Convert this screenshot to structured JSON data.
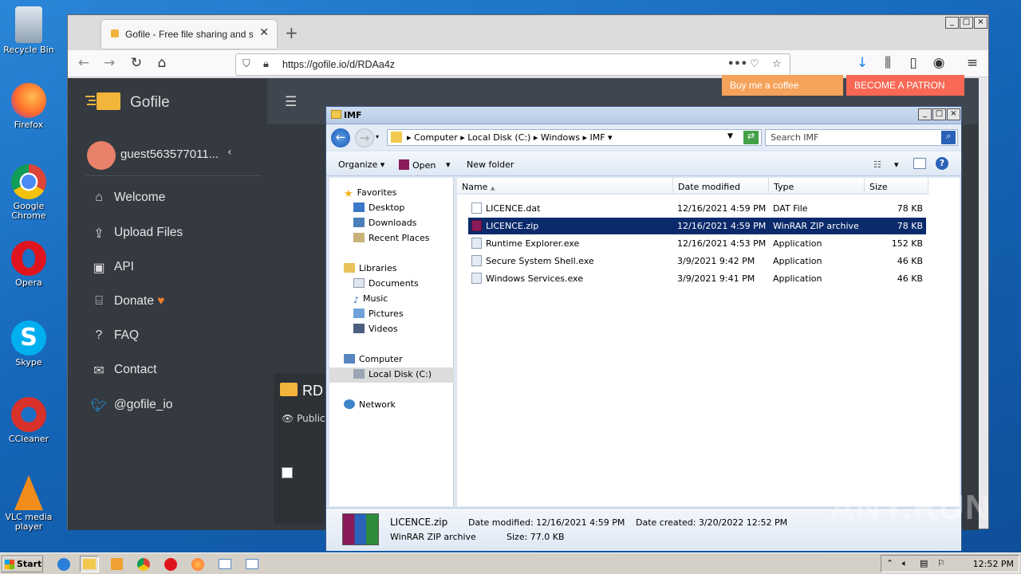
{
  "desktop": {
    "icons": [
      {
        "label": "Recycle Bin"
      },
      {
        "label": "Firefox"
      },
      {
        "label": "Google Chrome"
      },
      {
        "label": "Opera"
      },
      {
        "label": "Skype"
      },
      {
        "label": "CCleaner"
      },
      {
        "label": "VLC media player"
      }
    ]
  },
  "browser": {
    "tab_title": "Gofile - Free file sharing and storage",
    "url": "https://gofile.io/d/RDAa4z",
    "new_tab_glyph": "+",
    "tab_close_glyph": "✕"
  },
  "gofile": {
    "logo_text": "Gofile",
    "username": "guest563577011...",
    "menu": [
      {
        "icon": "home-icon",
        "label": "Welcome"
      },
      {
        "icon": "upload-icon",
        "label": "Upload Files"
      },
      {
        "icon": "api-icon",
        "label": "API"
      },
      {
        "icon": "gift-icon",
        "label": "Donate"
      },
      {
        "icon": "question-icon",
        "label": "FAQ"
      },
      {
        "icon": "envelope-icon",
        "label": "Contact"
      },
      {
        "icon": "twitter-icon",
        "label": "@gofile_io"
      }
    ],
    "buy_coffee_label": "Buy me a coffee",
    "patron_label": "BECOME A PATRON",
    "folder_title": "RD",
    "public_label": "Public"
  },
  "explorer": {
    "title": "IMF",
    "breadcrumb": [
      "Computer",
      "Local Disk (C:)",
      "Windows",
      "IMF"
    ],
    "search_placeholder": "Search IMF",
    "toolbar": {
      "organize": "Organize",
      "open": "Open",
      "new_folder": "New folder"
    },
    "nav": {
      "favorites": "Favorites",
      "desktop": "Desktop",
      "downloads": "Downloads",
      "recent": "Recent Places",
      "libraries": "Libraries",
      "documents": "Documents",
      "music": "Music",
      "pictures": "Pictures",
      "videos": "Videos",
      "computer": "Computer",
      "local_disk": "Local Disk (C:)",
      "network": "Network"
    },
    "columns": {
      "name": "Name",
      "date": "Date modified",
      "type": "Type",
      "size": "Size"
    },
    "files": [
      {
        "name": "LICENCE.dat",
        "date": "12/16/2021 4:59 PM",
        "type": "DAT File",
        "size": "78 KB"
      },
      {
        "name": "LICENCE.zip",
        "date": "12/16/2021 4:59 PM",
        "type": "WinRAR ZIP archive",
        "size": "78 KB"
      },
      {
        "name": "Runtime Explorer.exe",
        "date": "12/16/2021 4:53 PM",
        "type": "Application",
        "size": "152 KB"
      },
      {
        "name": "Secure System Shell.exe",
        "date": "3/9/2021 9:42 PM",
        "type": "Application",
        "size": "46 KB"
      },
      {
        "name": "Windows Services.exe",
        "date": "3/9/2021 9:41 PM",
        "type": "Application",
        "size": "46 KB"
      }
    ],
    "selected_index": 1,
    "details": {
      "name": "LICENCE.zip",
      "type": "WinRAR ZIP archive",
      "date_modified_label": "Date modified:",
      "date_modified": "12/16/2021 4:59 PM",
      "date_created_label": "Date created:",
      "date_created": "3/20/2022 12:52 PM",
      "size_label": "Size:",
      "size": "77.0 KB"
    }
  },
  "taskbar": {
    "start_label": "Start",
    "clock": "12:52 PM"
  },
  "watermark": "ANY.RUN"
}
